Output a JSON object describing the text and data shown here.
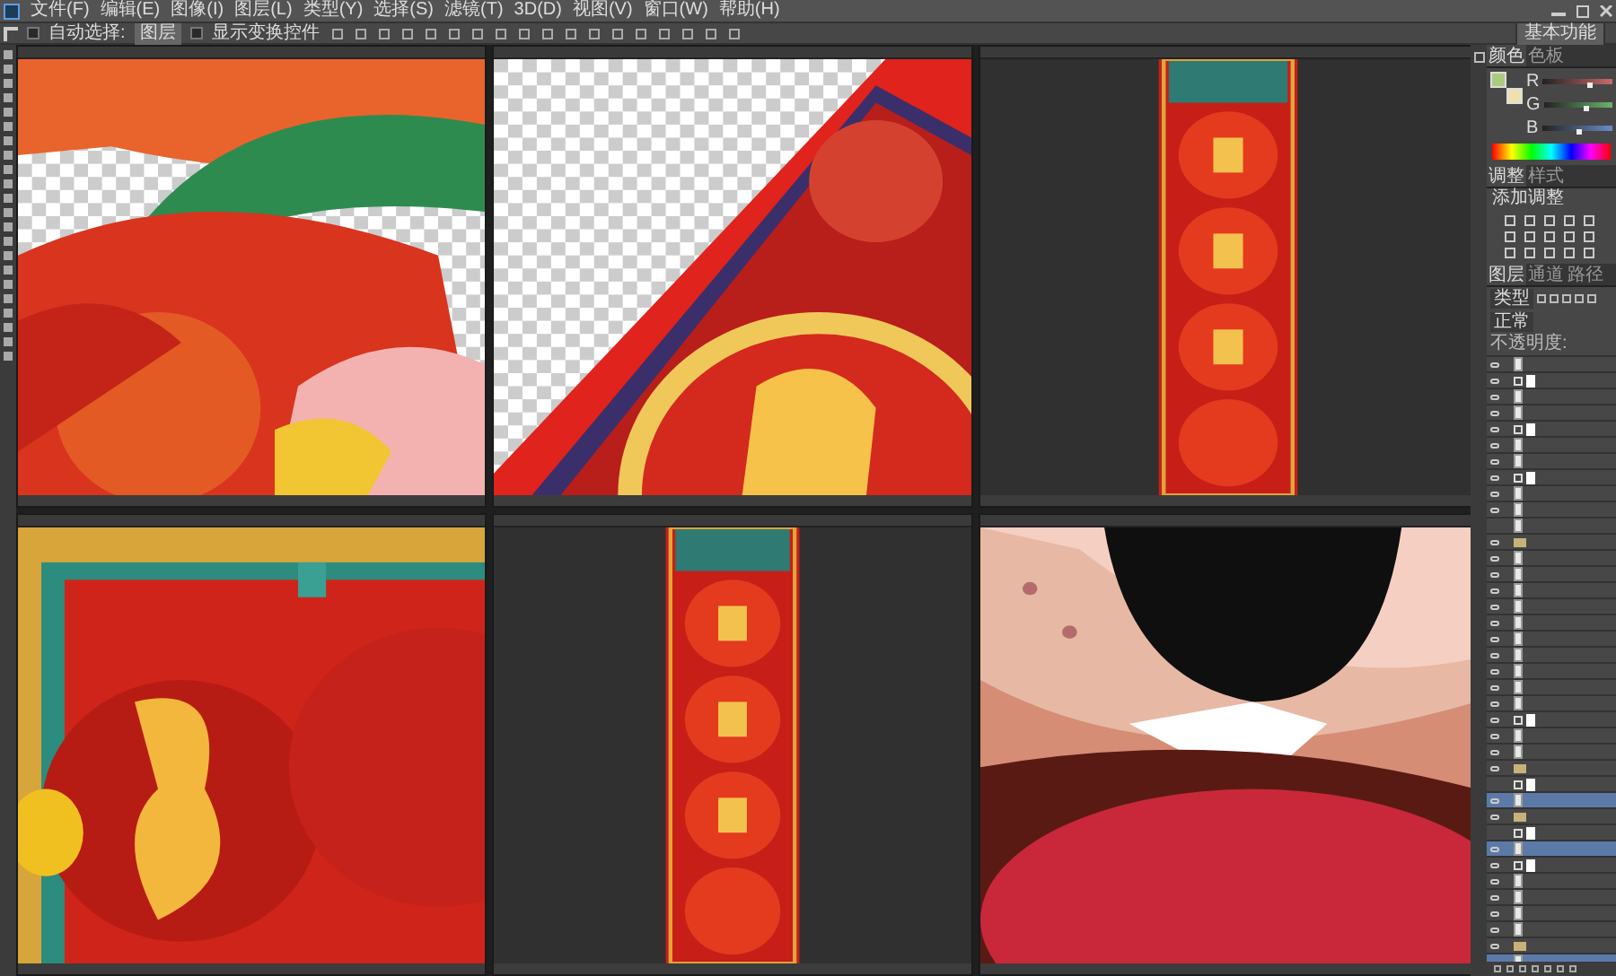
{
  "menu": [
    "文件(F)",
    "编辑(E)",
    "图像(I)",
    "图层(L)",
    "类型(Y)",
    "选择(S)",
    "滤镜(T)",
    "3D(D)",
    "视图(V)",
    "窗口(W)",
    "帮助(H)"
  ],
  "options_bar": {
    "auto_select": {
      "label": "自动选择:",
      "checked": false
    },
    "target": "图层",
    "show_transform": {
      "label": "显示变换控件",
      "checked": false
    }
  },
  "workspace": "基本功能",
  "color_panel": {
    "tabs": [
      {
        "label": "颜色",
        "selected": true
      },
      {
        "label": "色板",
        "selected": false
      }
    ],
    "channels": [
      {
        "label": "R",
        "level": 0.67
      },
      {
        "label": "G",
        "level": 0.6
      },
      {
        "label": "B",
        "level": 0.51
      }
    ]
  },
  "adjust_panel": {
    "tabs": [
      {
        "label": "调整",
        "selected": true
      },
      {
        "label": "样式",
        "selected": false
      }
    ],
    "title": "添加调整"
  },
  "layers_panel": {
    "tabs": [
      {
        "label": "图层",
        "selected": true
      },
      {
        "label": "通道",
        "selected": false
      },
      {
        "label": "路径",
        "selected": false
      }
    ],
    "filter": "类型",
    "blend": "正常",
    "opacity_label": "不透明度:",
    "rows": [
      {
        "kind": "layer",
        "visible": true,
        "selected": false
      },
      {
        "kind": "adjustment",
        "visible": true,
        "selected": false
      },
      {
        "kind": "layer",
        "visible": true,
        "selected": false
      },
      {
        "kind": "layer",
        "visible": true,
        "selected": false
      },
      {
        "kind": "adjustment",
        "visible": true,
        "selected": false
      },
      {
        "kind": "layer",
        "visible": true,
        "selected": false
      },
      {
        "kind": "layer",
        "visible": true,
        "selected": false
      },
      {
        "kind": "adjustment",
        "visible": true,
        "selected": false
      },
      {
        "kind": "layer",
        "visible": true,
        "selected": false
      },
      {
        "kind": "layer",
        "visible": true,
        "selected": false
      },
      {
        "kind": "layer",
        "visible": false,
        "selected": false
      },
      {
        "kind": "group",
        "visible": true,
        "selected": false
      },
      {
        "kind": "layer",
        "visible": true,
        "selected": false
      },
      {
        "kind": "layer",
        "visible": true,
        "selected": false
      },
      {
        "kind": "layer",
        "visible": true,
        "selected": false
      },
      {
        "kind": "layer",
        "visible": true,
        "selected": false
      },
      {
        "kind": "layer",
        "visible": true,
        "selected": false
      },
      {
        "kind": "layer",
        "visible": true,
        "selected": false
      },
      {
        "kind": "layer",
        "visible": true,
        "selected": false
      },
      {
        "kind": "layer",
        "visible": true,
        "selected": false
      },
      {
        "kind": "layer",
        "visible": true,
        "selected": false
      },
      {
        "kind": "layer",
        "visible": true,
        "selected": false
      },
      {
        "kind": "adjustment",
        "visible": true,
        "selected": false
      },
      {
        "kind": "layer",
        "visible": true,
        "selected": false
      },
      {
        "kind": "layer",
        "visible": true,
        "selected": false
      },
      {
        "kind": "group",
        "visible": true,
        "selected": false
      },
      {
        "kind": "adjustment",
        "visible": false,
        "selected": false
      },
      {
        "kind": "layer",
        "visible": true,
        "selected": true
      },
      {
        "kind": "group",
        "visible": true,
        "selected": false
      },
      {
        "kind": "adjustment",
        "visible": false,
        "selected": false
      },
      {
        "kind": "layer",
        "visible": true,
        "selected": true
      },
      {
        "kind": "adjustment",
        "visible": true,
        "selected": false
      },
      {
        "kind": "layer",
        "visible": true,
        "selected": false
      },
      {
        "kind": "layer",
        "visible": true,
        "selected": false
      },
      {
        "kind": "layer",
        "visible": true,
        "selected": false
      },
      {
        "kind": "layer",
        "visible": true,
        "selected": false
      },
      {
        "kind": "group",
        "visible": true,
        "selected": false
      },
      {
        "kind": "layer",
        "visible": false,
        "selected": true
      }
    ]
  }
}
